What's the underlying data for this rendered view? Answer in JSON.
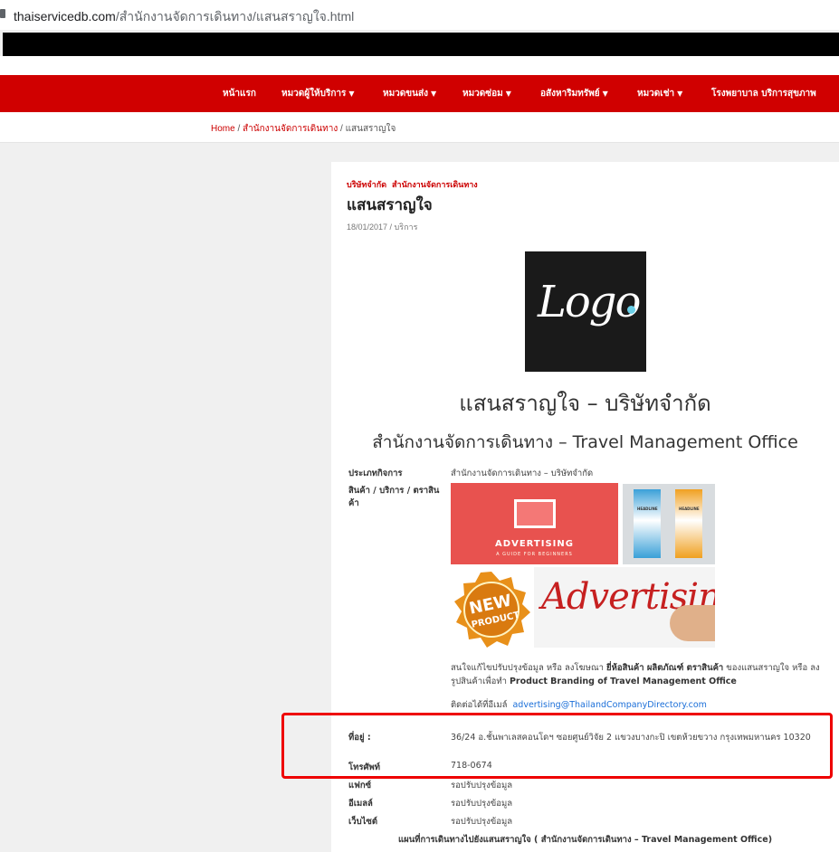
{
  "browser": {
    "url_domain": "thaiservicedb.com",
    "url_path": "/สำนักงานจัดการเดินทาง/แสนสราญใจ.html"
  },
  "nav": {
    "items": [
      {
        "label": "หน้าแรก",
        "has_dropdown": false
      },
      {
        "label": "หมวดผู้ให้บริการ",
        "has_dropdown": true
      },
      {
        "label": "หมวดขนส่ง",
        "has_dropdown": true
      },
      {
        "label": "หมวดซ่อม",
        "has_dropdown": true
      },
      {
        "label": "อสังหาริมทรัพย์",
        "has_dropdown": true
      },
      {
        "label": "หมวดเช่า",
        "has_dropdown": true
      },
      {
        "label": "โรงพยาบาล บริการสุขภาพ",
        "has_dropdown": false
      }
    ]
  },
  "breadcrumb": {
    "home": "Home",
    "sep": "/",
    "category": "สำนักงานจัดการเดินทาง",
    "current": "แสนสราญใจ"
  },
  "post": {
    "categories": [
      "บริษัทจำกัด",
      "สำนักงานจัดการเดินทาง"
    ],
    "title": "แสนสราญใจ",
    "meta": "18/01/2017 / บริการ",
    "logo_text": "Logo",
    "heading": "แสนสราญใจ – บริษัทจำกัด",
    "subheading": "สำนักงานจัดการเดินทาง – Travel Management Office"
  },
  "details": {
    "business_type_label": "ประเภทกิจการ",
    "business_type_value": "สำนักงานจัดการเดินทาง – บริษัทจำกัด",
    "products_label": "สินค้า / บริการ / ตราสินค้า",
    "ad_image_caption": "ADVERTISING",
    "ad_image_sub": "A GUIDE FOR BEGINNERS",
    "rollup_text": "HEADLINE",
    "new_product_line1": "NEW",
    "new_product_line2": "PRODUCT",
    "advertising_script": "Advertising",
    "promo_part1": "สนใจแก้ไขปรับปรุงข้อมูล หรือ ลงโฆษณา ",
    "promo_bold1": "ยี่ห้อสินค้า ผลิตภัณฑ์ ตราสินค้า",
    "promo_part2": " ของแสนสราญใจ หรือ ลงรูปสินค้าเพื่อทำ ",
    "promo_bold2": "Product Branding of Travel Management Office",
    "contact_label": "ติดต่อได้ที่อีเมล์",
    "contact_email": "advertising@ThailandCompanyDirectory.com",
    "address_label": "ที่อยู่ :",
    "address_value": "36/24 อ.ชั้นพาเลสคอนโดฯ ซอยศูนย์วิจัย 2 แขวงบางกะปิ เขตห้วยขวาง กรุงเทพมหานคร 10320",
    "phone_label": "โทรศัพท์",
    "phone_value": "718-0674",
    "fax_label": "แฟกซ์",
    "fax_value": "รอปรับปรุงข้อมูล",
    "email_label": "อีเมลล์",
    "email_value": "รอปรับปรุงข้อมูล",
    "website_label": "เว็บไซต์",
    "website_value": "รอปรับปรุงข้อมูล",
    "map_title": "แผนที่การเดินทางไปยังแสนสราญใจ ( สำนักงานจัดการเดินทาง – Travel Management Office)"
  },
  "colors": {
    "nav_bg": "#d00000",
    "accent_link": "#cc0000",
    "highlight_box": "#ee0000"
  }
}
